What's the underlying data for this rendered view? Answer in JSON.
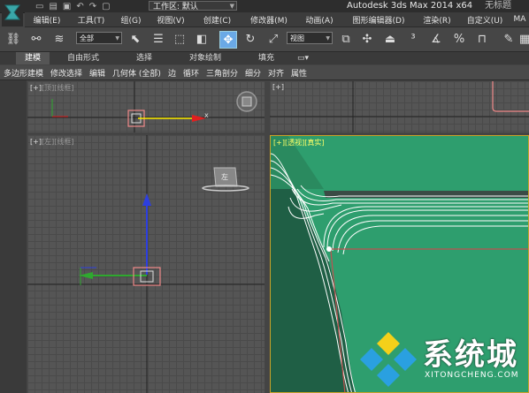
{
  "titlebar": {
    "workspace_label": "工作区: 默认",
    "app_title": "Autodesk 3ds Max  2014 x64",
    "file_title": "无标题"
  },
  "menu": [
    "编辑(E)",
    "工具(T)",
    "组(G)",
    "视图(V)",
    "创建(C)",
    "修改器(M)",
    "动画(A)",
    "图形编辑器(D)",
    "渲染(R)",
    "自定义(U)",
    "MA"
  ],
  "toolbar": {
    "selection_filter": "全部",
    "reference_coord": "视图"
  },
  "ribbon": {
    "tabs": [
      "建模",
      "自由形式",
      "选择",
      "对象绘制",
      "填充"
    ],
    "row": [
      "多边形建模",
      "修改选择",
      "编辑",
      "几何体 (全部)",
      "边",
      "循环",
      "三角剖分",
      "细分",
      "对齐",
      "属性"
    ]
  },
  "viewports": {
    "top": {
      "plus": "[+]",
      "name": "[顶]",
      "mode": "[线框]"
    },
    "topright": {
      "plus": "[+]"
    },
    "left": {
      "plus": "[+]",
      "name": "[左]",
      "mode": "[线框]"
    },
    "persp": {
      "plus": "[+]",
      "name": "[透视]",
      "mode": "[真实]"
    }
  },
  "axis_x_label": "x",
  "viewcube_label": "左",
  "watermark": {
    "text": "系统城",
    "url": "XITONGCHENG.COM"
  },
  "colors": {
    "box_fill": "#2e9e6e",
    "active_viewport_border": "#c9a227",
    "axis_x": "#e02020",
    "axis_y": "#2fa82f",
    "axis_z": "#2d3fe0"
  }
}
